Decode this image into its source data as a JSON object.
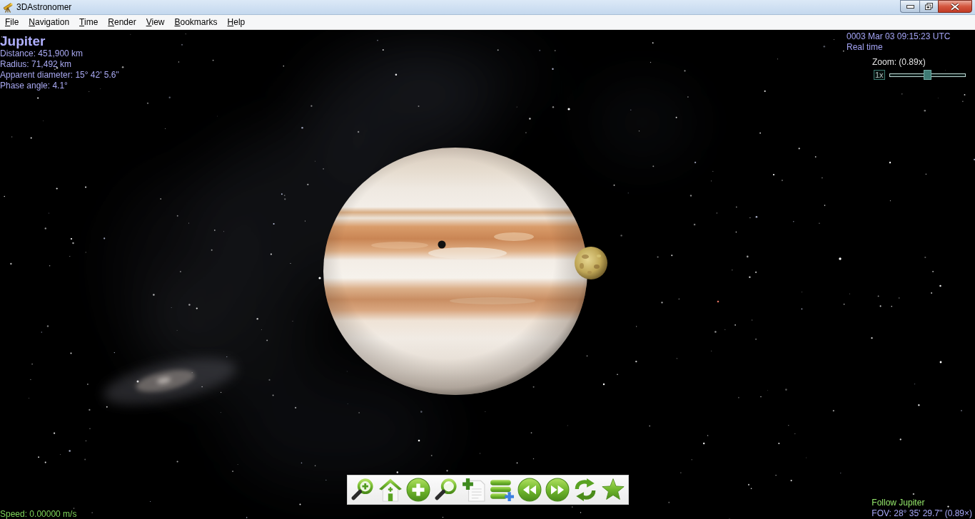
{
  "window": {
    "title": "3DAstronomer"
  },
  "menu": [
    "File",
    "Navigation",
    "Time",
    "Render",
    "View",
    "Bookmarks",
    "Help"
  ],
  "selected_object": {
    "name": "Jupiter",
    "details": [
      "Distance: 451,900 km",
      "Radius: 71,492 km",
      "Apparent diameter: 15° 42' 5.6\"",
      "Phase angle: 4.1°"
    ]
  },
  "clock": {
    "date_time": "0003 Mar 03 09:15:23 UTC",
    "rate": "Real time"
  },
  "zoom": {
    "label": "Zoom: (0.89x)",
    "reset_button": "1x",
    "level": 0.5
  },
  "status": {
    "speed": "Speed: 0.00000 m/s",
    "follow": "Follow Jupiter",
    "fov": "FOV: 28° 35' 29.7\" (0.89×)"
  }
}
